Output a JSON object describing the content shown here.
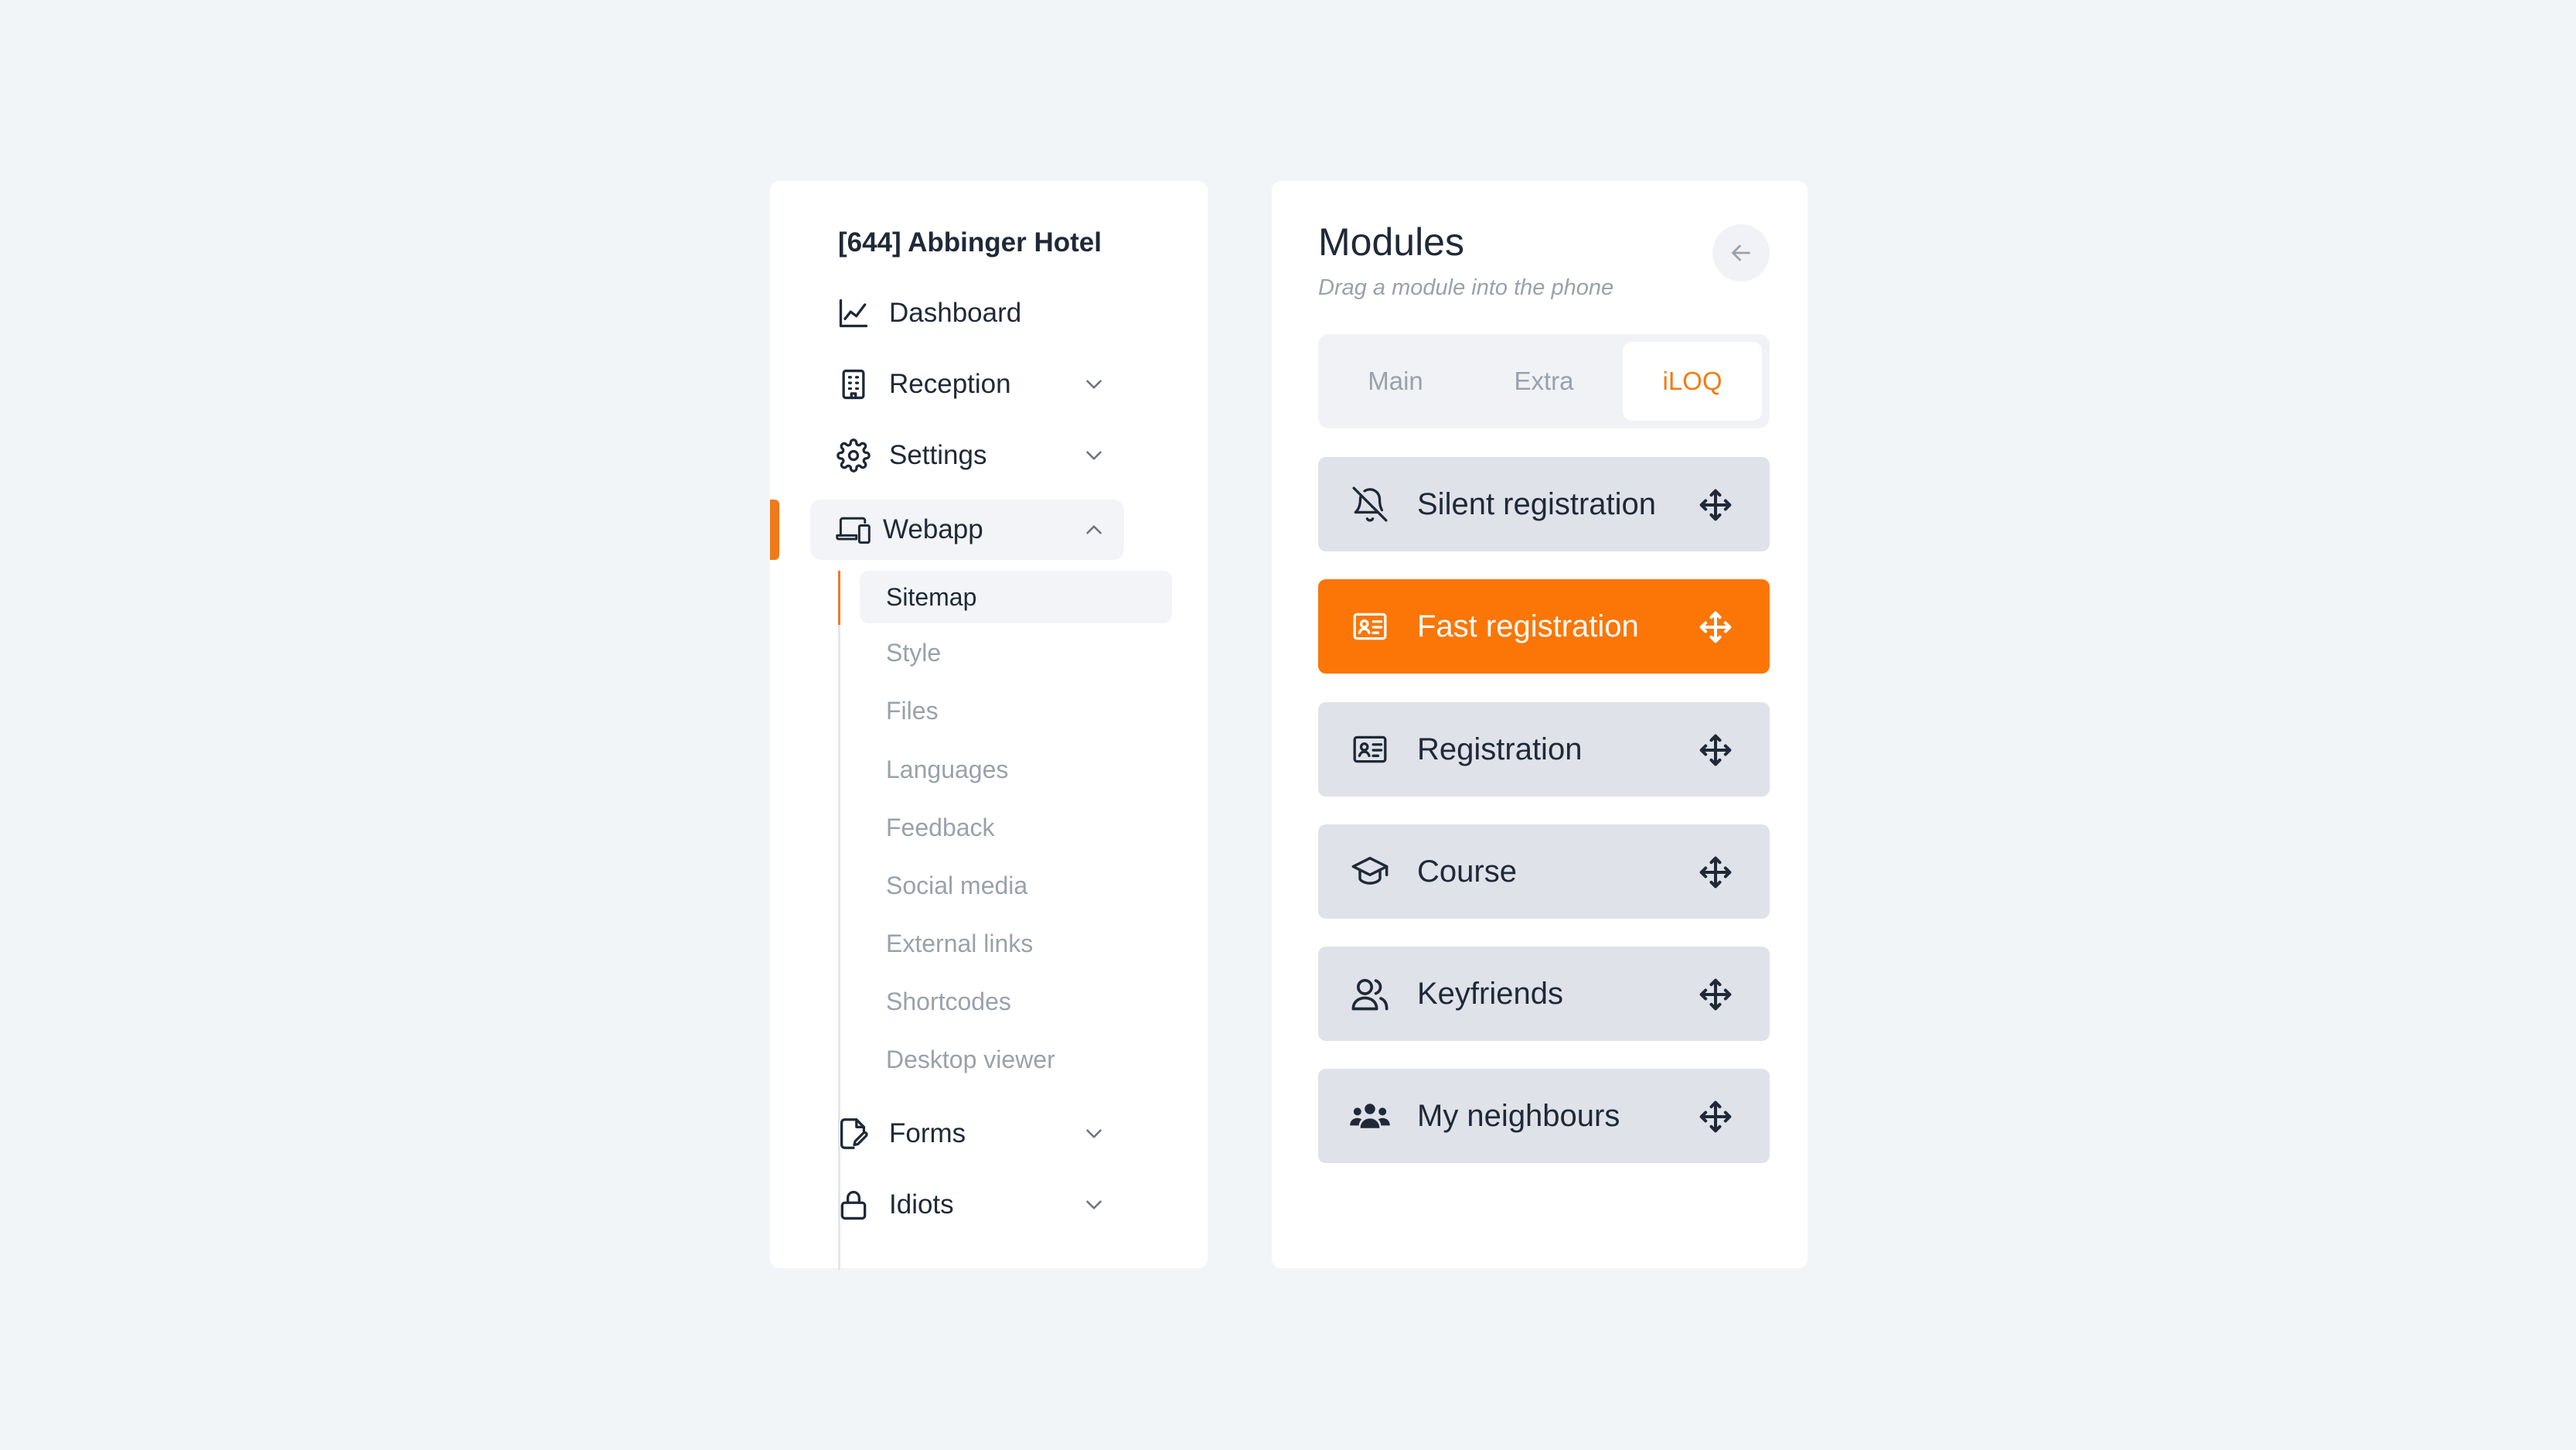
{
  "sidebar": {
    "hotel_title": "[644] Abbinger Hotel",
    "items": [
      {
        "label": "Dashboard",
        "icon": "chart-line-icon",
        "expandable": false
      },
      {
        "label": "Reception",
        "icon": "building-icon",
        "expandable": true,
        "expanded": false
      },
      {
        "label": "Settings",
        "icon": "gear-icon",
        "expandable": true,
        "expanded": false
      },
      {
        "label": "Webapp",
        "icon": "devices-icon",
        "expandable": true,
        "expanded": true,
        "active": true
      },
      {
        "label": "Forms",
        "icon": "form-edit-icon",
        "expandable": true,
        "expanded": false
      },
      {
        "label": "Idiots",
        "icon": "lock-icon",
        "expandable": true,
        "expanded": false
      }
    ],
    "webapp_subitems": [
      {
        "label": "Sitemap",
        "current": true
      },
      {
        "label": "Style"
      },
      {
        "label": "Files"
      },
      {
        "label": "Languages"
      },
      {
        "label": "Feedback"
      },
      {
        "label": "Social media"
      },
      {
        "label": "External links"
      },
      {
        "label": "Shortcodes"
      },
      {
        "label": "Desktop viewer"
      }
    ]
  },
  "modules_panel": {
    "title": "Modules",
    "subtitle": "Drag a module into the phone",
    "back_icon": "arrow-left-icon",
    "tabs": [
      {
        "label": "Main"
      },
      {
        "label": "Extra"
      },
      {
        "label": "iLOQ",
        "selected": true
      }
    ],
    "modules": [
      {
        "label": "Silent registration",
        "icon": "bell-off-icon"
      },
      {
        "label": "Fast registration",
        "icon": "id-card-icon",
        "highlighted": true
      },
      {
        "label": "Registration",
        "icon": "id-card-icon"
      },
      {
        "label": "Course",
        "icon": "graduation-cap-icon"
      },
      {
        "label": "Keyfriends",
        "icon": "users-icon"
      },
      {
        "label": "My neighbours",
        "icon": "user-group-icon"
      }
    ],
    "drag_icon": "move-icon"
  },
  "colors": {
    "accent": "#fb7606",
    "page_bg": "#f2f5f8",
    "module_bg": "#dfe2e9",
    "muted_text": "#9aa1ab"
  }
}
